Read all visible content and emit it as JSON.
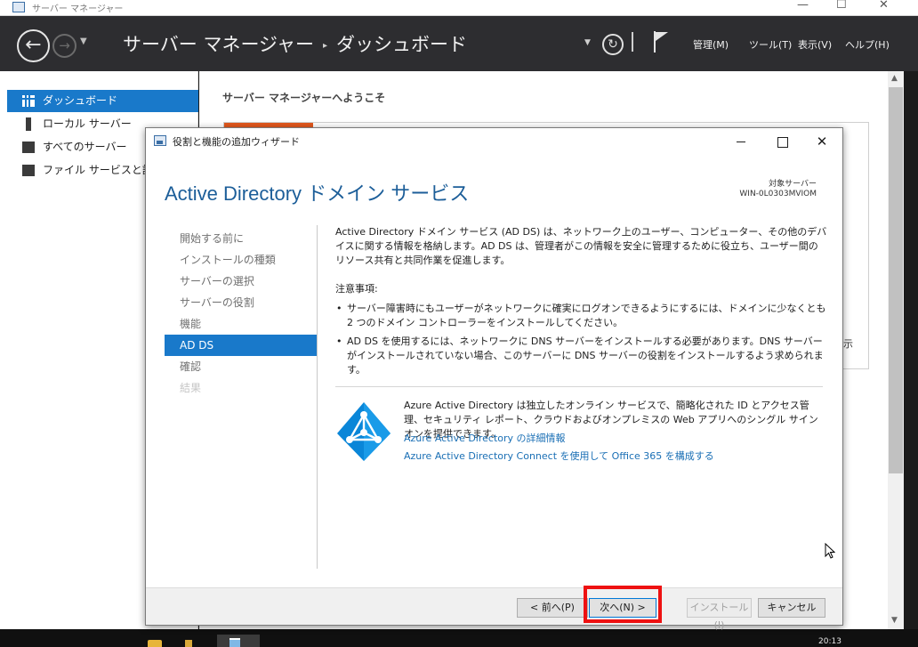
{
  "server_manager": {
    "window_title": "サーバー マネージャー",
    "window_controls": {
      "minimize": "—",
      "maximize": "☐",
      "close": "✕"
    },
    "breadcrumb": {
      "root": "サーバー マネージャー",
      "separator": "▸",
      "current": "ダッシュボード"
    },
    "menu": {
      "manage": "管理(M)",
      "tools": "ツール(T)",
      "view": "表示(V)",
      "help": "ヘルプ(H)"
    },
    "sidebar": [
      {
        "label": "ダッシュボード",
        "icon": "dashboard-icon",
        "active": true
      },
      {
        "label": "ローカル サーバー",
        "icon": "server-icon",
        "active": false
      },
      {
        "label": "すべてのサーバー",
        "icon": "servers-icon",
        "active": false
      },
      {
        "label": "ファイル サービスと記憶域サービス",
        "icon": "files-icon",
        "active": false
      }
    ],
    "welcome": "サーバー マネージャーへようこそ",
    "peek_text": "示"
  },
  "wizard": {
    "title": "役割と機能の追加ウィザード",
    "heading": "Active Directory ドメイン サービス",
    "target_label": "対象サーバー",
    "target_name": "WIN-0L0303MVIOM",
    "steps": [
      {
        "label": "開始する前に",
        "state": "normal"
      },
      {
        "label": "インストールの種類",
        "state": "normal"
      },
      {
        "label": "サーバーの選択",
        "state": "normal"
      },
      {
        "label": "サーバーの役割",
        "state": "normal"
      },
      {
        "label": "機能",
        "state": "normal"
      },
      {
        "label": "AD DS",
        "state": "current"
      },
      {
        "label": "確認",
        "state": "normal"
      },
      {
        "label": "結果",
        "state": "disabled"
      }
    ],
    "intro": "Active Directory ドメイン サービス (AD DS) は、ネットワーク上のユーザー、コンピューター、その他のデバイスに関する情報を格納します。AD DS は、管理者がこの情報を安全に管理するために役立ち、ユーザー間のリソース共有と共同作業を促進します。",
    "notes_title": "注意事項:",
    "notes": [
      "サーバー障害時にもユーザーがネットワークに確実にログオンできるようにするには、ドメインに少なくとも 2 つのドメイン コントローラーをインストールしてください。",
      "AD DS を使用するには、ネットワークに DNS サーバーをインストールする必要があります。DNS サーバーがインストールされていない場合、このサーバーに DNS サーバーの役割をインストールするよう求められます。"
    ],
    "azure_text": "Azure Active Directory は独立したオンライン サービスで、簡略化された ID とアクセス管理、セキュリティ レポート、クラウドおよびオンプレミスの Web アプリへのシングル サインオンを提供できます。",
    "azure_links": [
      "Azure Active Directory の詳細情報",
      "Azure Active Directory Connect を使用して Office 365 を構成する"
    ],
    "buttons": {
      "prev": "< 前へ(P)",
      "next": "次へ(N) >",
      "install": "インストール(I)",
      "cancel": "キャンセル"
    }
  },
  "taskbar": {
    "clock": "20:13"
  },
  "colors": {
    "accent": "#1979ca",
    "header_bg": "#2d2d30",
    "highlight": "#ee1111",
    "link": "#1a6fb5"
  }
}
